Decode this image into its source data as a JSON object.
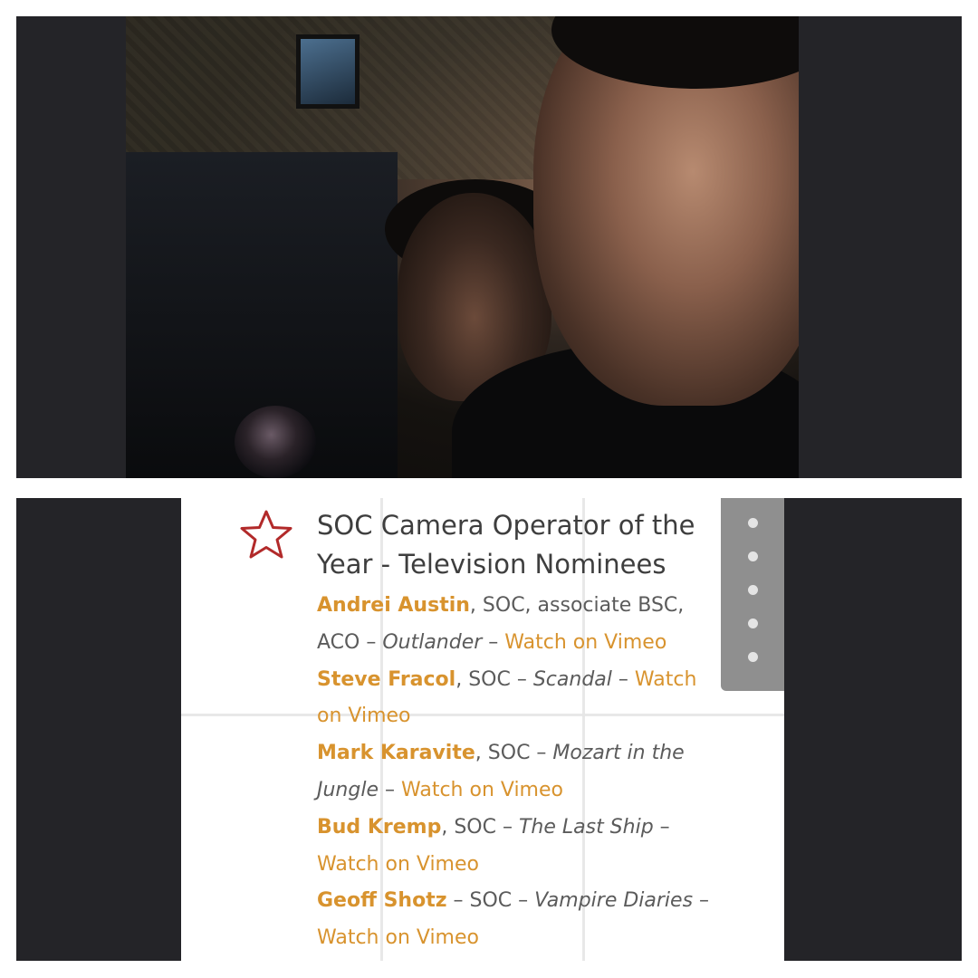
{
  "photo": {
    "subject": "selfie-on-set"
  },
  "article": {
    "icon": "star-outline-icon",
    "title": "SOC Camera Operator of the Year - Television Nominees",
    "link_color": "#d8932e",
    "icon_color": "#b22a2a",
    "nominees": [
      {
        "name": "Andrei Austin",
        "credit": ", SOC, associate BSC, ACO – ",
        "show": "Outlander",
        "sep": " – ",
        "link": "Watch on Vimeo"
      },
      {
        "name": "Steve Fracol",
        "credit": ", SOC – ",
        "show": "Scandal",
        "sep": " – ",
        "link": "Watch on Vimeo"
      },
      {
        "name": "Mark Karavite",
        "credit": ", SOC – ",
        "show": "Mozart in the Jungle",
        "sep": " – ",
        "link": "Watch on Vimeo"
      },
      {
        "name": "Bud Kremp",
        "credit": ", SOC – ",
        "show": "The Last Ship",
        "sep": " – ",
        "link": "Watch on Vimeo"
      },
      {
        "name": "Geoff Shotz",
        "credit": "  – SOC – ",
        "show": "Vampire Diaries",
        "sep": " – ",
        "link": "Watch on Vimeo"
      }
    ]
  },
  "scroll_menu": {
    "icon": "vertical-dots-icon",
    "dot_count": 5
  }
}
